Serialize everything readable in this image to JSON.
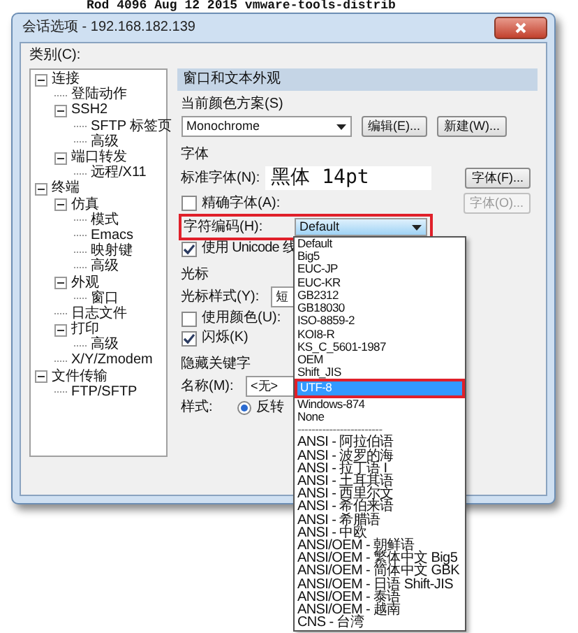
{
  "terminal": {
    "text": "Rod  4096 Aug 12  2015 vmware-tools-distrib"
  },
  "window": {
    "title": "会话选项 - 192.168.182.139"
  },
  "category": {
    "label": "类别(C):",
    "tree": [
      {
        "label": "连接",
        "expanded": true,
        "children": [
          {
            "label": "登陆动作"
          },
          {
            "label": "SSH2",
            "expanded": true,
            "children": [
              {
                "label": "SFTP 标签页"
              },
              {
                "label": "高级"
              }
            ]
          },
          {
            "label": "端口转发",
            "expanded": true,
            "children": [
              {
                "label": "远程/X11"
              }
            ]
          }
        ]
      },
      {
        "label": "终端",
        "expanded": true,
        "children": [
          {
            "label": "仿真",
            "expanded": true,
            "children": [
              {
                "label": "模式"
              },
              {
                "label": "Emacs"
              },
              {
                "label": "映射键"
              },
              {
                "label": "高级"
              }
            ]
          },
          {
            "label": "外观",
            "expanded": true,
            "children": [
              {
                "label": "窗口"
              }
            ]
          },
          {
            "label": "日志文件"
          },
          {
            "label": "打印",
            "expanded": true,
            "children": [
              {
                "label": "高级"
              }
            ]
          },
          {
            "label": "X/Y/Zmodem"
          }
        ]
      },
      {
        "label": "文件传输",
        "expanded": true,
        "children": [
          {
            "label": "FTP/SFTP"
          }
        ]
      }
    ]
  },
  "panel": {
    "title": "窗口和文本外观",
    "color_scheme": {
      "label": "当前颜色方案(S)",
      "value": "Monochrome",
      "buttons": [
        "编辑(E)...",
        "新建(W)..."
      ]
    },
    "font": {
      "heading": "字体",
      "standard_label": "标准字体(N):",
      "standard_value": "黑体 14pt",
      "font_button": "字体(F)...",
      "precise": {
        "label": "精确字体(A):",
        "checked": false
      },
      "precise_button": {
        "label": "字体(O)...",
        "disabled": true
      },
      "encoding": {
        "label": "字符编码(H):",
        "value": "Default",
        "focused": true,
        "annotated": true
      },
      "unicode": {
        "label": "使用 Unicode 线",
        "checked": true
      }
    },
    "cursor": {
      "heading": "光标",
      "style_label": "光标样式(Y):",
      "style_value": "短",
      "use_color": {
        "label": "使用颜色(U):",
        "checked": false
      },
      "blink": {
        "label": "闪烁(K)",
        "checked": true
      }
    },
    "keywords": {
      "heading": "隐藏关键字",
      "name_label": "名称(M):",
      "name_value": "<无>",
      "style_label": "样式:",
      "style_option": {
        "label": "反转",
        "selected": true
      }
    }
  },
  "encoding_list": [
    {
      "kind": "option",
      "label": "Default",
      "selected": false,
      "annotated": false
    },
    {
      "kind": "option",
      "label": "Big5",
      "selected": false,
      "annotated": false
    },
    {
      "kind": "option",
      "label": "EUC-JP",
      "selected": false,
      "annotated": false
    },
    {
      "kind": "option",
      "label": "EUC-KR",
      "selected": false,
      "annotated": false
    },
    {
      "kind": "option",
      "label": "GB2312",
      "selected": false,
      "annotated": false
    },
    {
      "kind": "option",
      "label": "GB18030",
      "selected": false,
      "annotated": false
    },
    {
      "kind": "option",
      "label": "ISO-8859-2",
      "selected": false,
      "annotated": false
    },
    {
      "kind": "option",
      "label": "KOI8-R",
      "selected": false,
      "annotated": false
    },
    {
      "kind": "option",
      "label": "KS_C_5601-1987",
      "selected": false,
      "annotated": false
    },
    {
      "kind": "option",
      "label": "OEM",
      "selected": false,
      "annotated": false
    },
    {
      "kind": "option",
      "label": "Shift_JIS",
      "selected": false,
      "annotated": false
    },
    {
      "kind": "option",
      "label": "UTF-8",
      "selected": true,
      "annotated": true
    },
    {
      "kind": "option",
      "label": "Windows-874",
      "selected": false,
      "annotated": false
    },
    {
      "kind": "option",
      "label": "None",
      "selected": false,
      "annotated": false
    },
    {
      "kind": "separator",
      "label": "------------------------"
    },
    {
      "kind": "option",
      "label": "ANSI - 阿拉伯语",
      "selected": false,
      "annotated": false
    },
    {
      "kind": "option",
      "label": "ANSI - 波罗的海",
      "selected": false,
      "annotated": false
    },
    {
      "kind": "option",
      "label": "ANSI - 拉丁语 I",
      "selected": false,
      "annotated": false
    },
    {
      "kind": "option",
      "label": "ANSI - 土耳其语",
      "selected": false,
      "annotated": false
    },
    {
      "kind": "option",
      "label": "ANSI - 西里尔文",
      "selected": false,
      "annotated": false
    },
    {
      "kind": "option",
      "label": "ANSI - 希伯来语",
      "selected": false,
      "annotated": false
    },
    {
      "kind": "option",
      "label": "ANSI - 希腊语",
      "selected": false,
      "annotated": false
    },
    {
      "kind": "option",
      "label": "ANSI - 中欧",
      "selected": false,
      "annotated": false
    },
    {
      "kind": "option",
      "label": "ANSI/OEM - 朝鲜语",
      "selected": false,
      "annotated": false
    },
    {
      "kind": "option",
      "label": "ANSI/OEM - 繁体中文 Big5",
      "selected": false,
      "annotated": false
    },
    {
      "kind": "option",
      "label": "ANSI/OEM - 简体中文 GBK",
      "selected": false,
      "annotated": false
    },
    {
      "kind": "option",
      "label": "ANSI/OEM - 日语 Shift-JIS",
      "selected": false,
      "annotated": false
    },
    {
      "kind": "option",
      "label": "ANSI/OEM - 泰语",
      "selected": false,
      "annotated": false
    },
    {
      "kind": "option",
      "label": "ANSI/OEM - 越南",
      "selected": false,
      "annotated": false
    },
    {
      "kind": "option",
      "label": "CNS - 台湾",
      "selected": false,
      "annotated": false
    }
  ]
}
